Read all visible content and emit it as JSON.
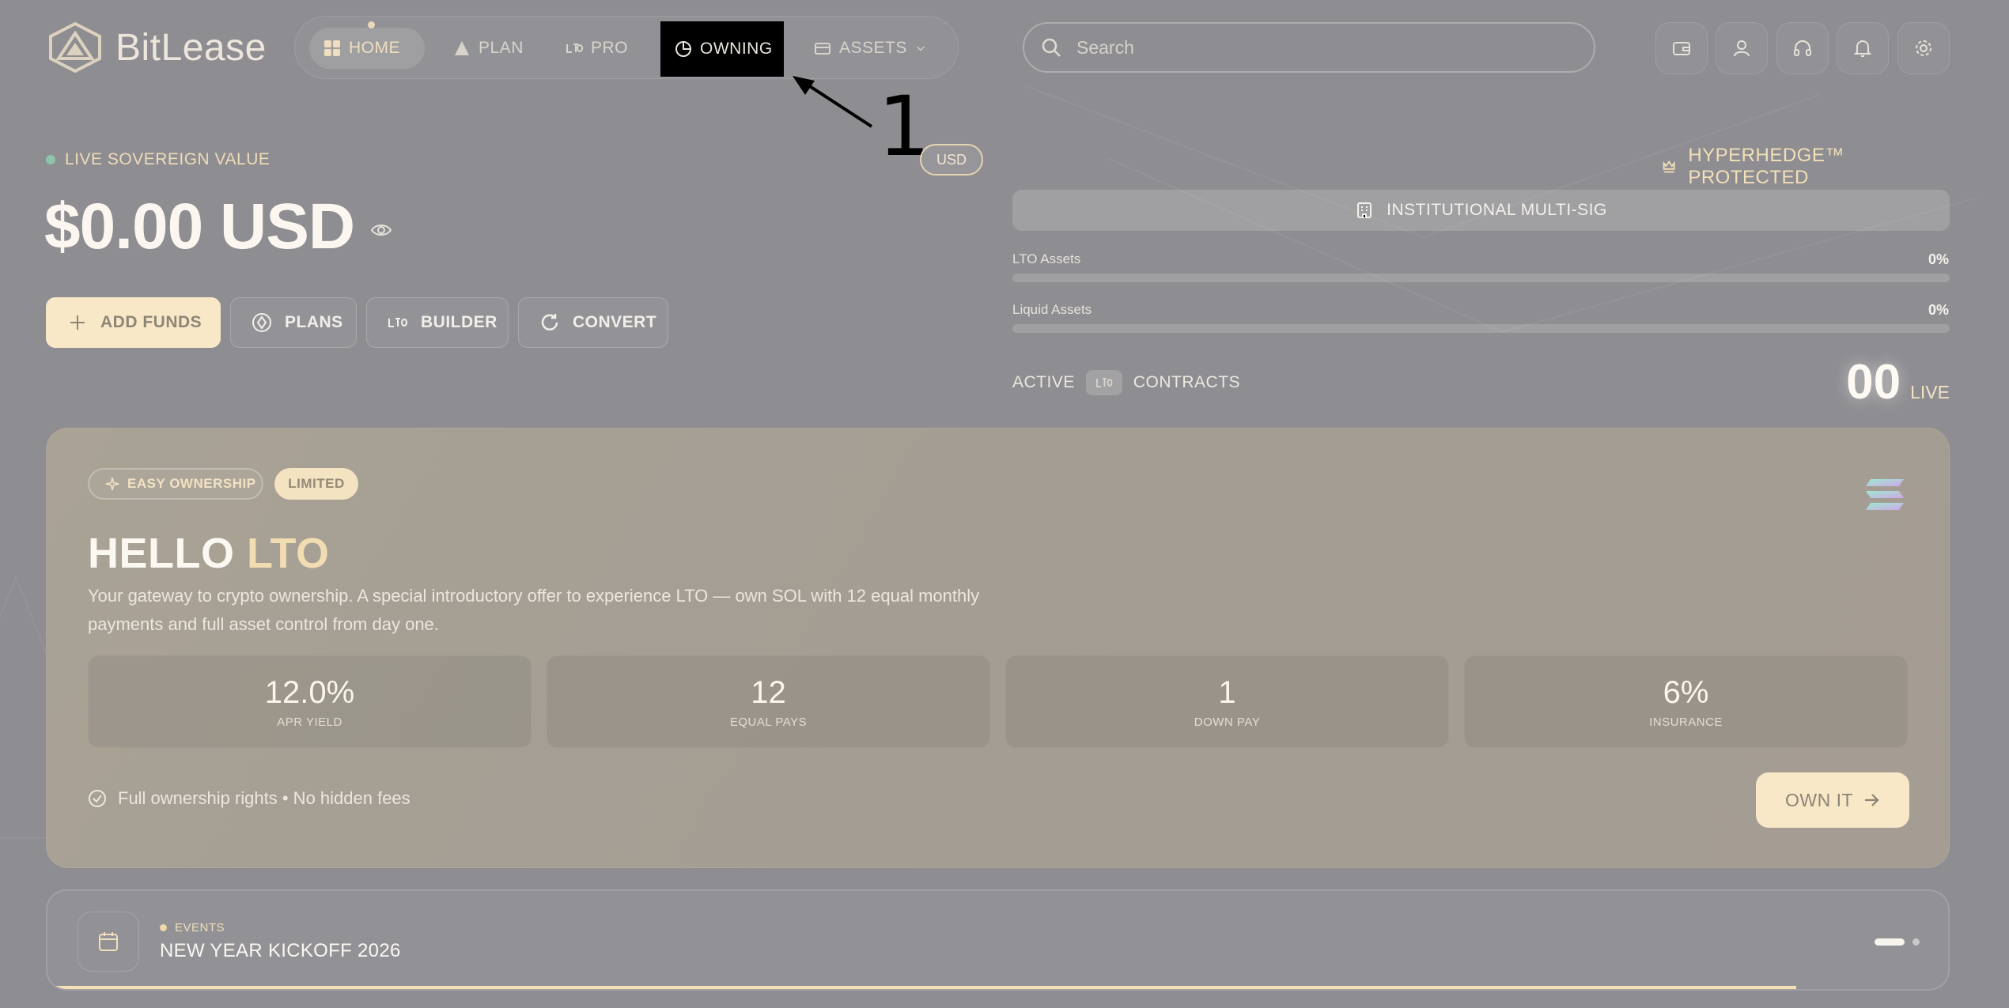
{
  "brand": {
    "name": "BitLease"
  },
  "nav": {
    "items": [
      {
        "label": "HOME",
        "icon": "grid-icon"
      },
      {
        "label": "PLAN",
        "icon": "triangle-icon"
      },
      {
        "label": "PRO",
        "icon": "lto-icon"
      },
      {
        "label": "OWNING",
        "icon": "pie-chart-icon"
      },
      {
        "label": "ASSETS",
        "icon": "wallet-icon"
      }
    ],
    "active": "HOME"
  },
  "search": {
    "placeholder": "Search"
  },
  "toolbar_icons": [
    "wallet-icon",
    "user-icon",
    "headset-icon",
    "bell-icon",
    "gear-icon"
  ],
  "annotation": {
    "label": "1"
  },
  "summary": {
    "live_label": "LIVE SOVEREIGN VALUE",
    "balance": "$0.00 USD",
    "currency_chip": "USD",
    "actions": {
      "add_funds": "ADD FUNDS",
      "plans": "PLANS",
      "builder": "BUILDER",
      "convert": "CONVERT"
    }
  },
  "security": {
    "hyperhedge": "HYPERHEDGE™ PROTECTED",
    "multisig": "INSTITUTIONAL MULTI-SIG",
    "allocations": [
      {
        "label": "LTO Assets",
        "percent": "0%",
        "fraction": 0
      },
      {
        "label": "Liquid Assets",
        "percent": "0%",
        "fraction": 0
      }
    ],
    "contracts": {
      "prefix": "ACTIVE",
      "suffix": "CONTRACTS",
      "count": "00",
      "status": "LIVE"
    }
  },
  "promo": {
    "tag": "EASY OWNERSHIP",
    "badge": "LIMITED",
    "title_main": "HELLO",
    "title_accent": "LTO",
    "description": "Your gateway to crypto ownership. A special introductory offer to experience LTO — own SOL with 12 equal monthly payments and full asset control from day one.",
    "stats": [
      {
        "value": "12.0%",
        "label": "APR YIELD"
      },
      {
        "value": "12",
        "label": "EQUAL PAYS"
      },
      {
        "value": "1",
        "label": "DOWN PAY"
      },
      {
        "value": "6%",
        "label": "INSURANCE"
      }
    ],
    "rights": "Full ownership rights • No hidden fees",
    "cta": "OWN IT",
    "colors": {
      "accent": "#f2dcb2",
      "button": "#f8e8c8"
    }
  },
  "events": {
    "tag": "EVENTS",
    "title": "NEW YEAR KICKOFF 2026",
    "progress_fraction": 0.92
  }
}
